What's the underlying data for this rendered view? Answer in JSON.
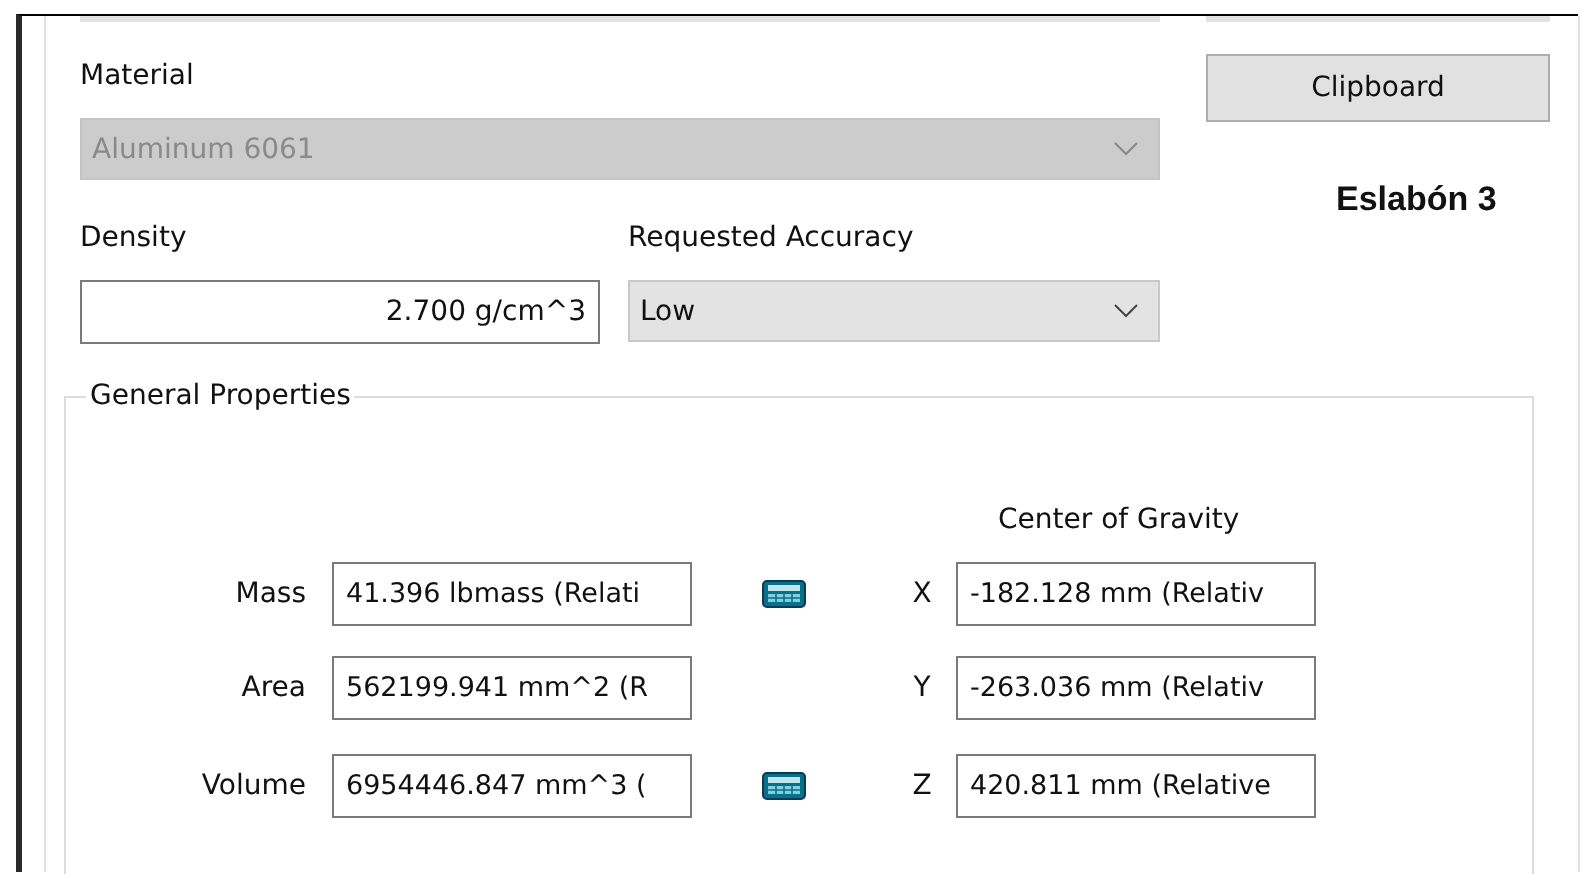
{
  "material": {
    "label": "Material",
    "value": "Aluminum 6061",
    "disabled": true
  },
  "clipboard_button": {
    "label": "Clipboard"
  },
  "note": "Eslabón 3",
  "density": {
    "label": "Density",
    "value": "2.700 g/cm^3"
  },
  "accuracy": {
    "label": "Requested Accuracy",
    "value": "Low",
    "disabled": false
  },
  "general_properties": {
    "title": "General Properties",
    "center_of_gravity_title": "Center of Gravity",
    "rows": [
      {
        "label": "Mass",
        "value": "41.396 lbmass (Relati",
        "calculator": true,
        "axis": "X",
        "cog_value": "-182.128 mm (Relativ"
      },
      {
        "label": "Area",
        "value": "562199.941 mm^2 (R",
        "calculator": false,
        "axis": "Y",
        "cog_value": "-263.036 mm (Relativ"
      },
      {
        "label": "Volume",
        "value": "6954446.847 mm^3 (",
        "calculator": true,
        "axis": "Z",
        "cog_value": "420.811 mm (Relative"
      }
    ]
  }
}
